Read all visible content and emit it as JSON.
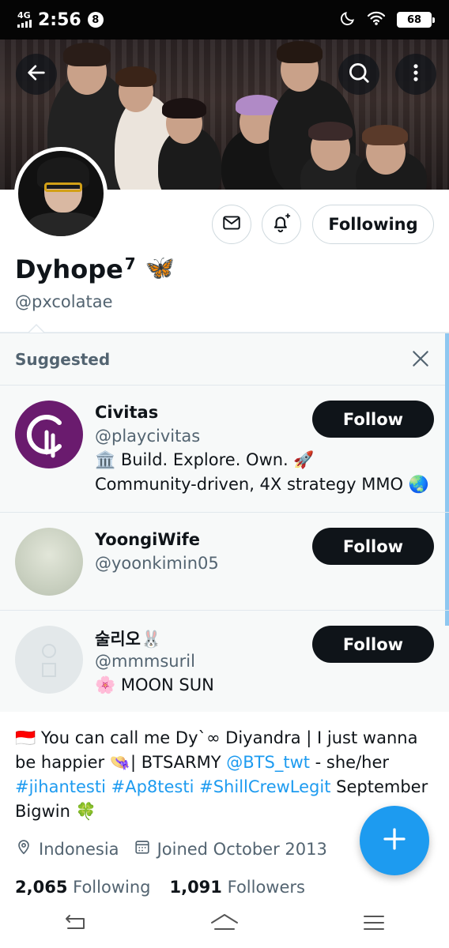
{
  "status_bar": {
    "network": "4G",
    "time": "2:56",
    "notification_count": "8",
    "battery": "68"
  },
  "profile": {
    "display_name": "Dyhope",
    "name_superscript": "7",
    "name_emoji": "🦋",
    "handle": "@pxcolatae",
    "following_label": "Following"
  },
  "suggested": {
    "title": "Suggested",
    "items": [
      {
        "name": "Civitas",
        "handle": "@playcivitas",
        "bio_line1": "🏛️ Build. Explore. Own. 🚀",
        "bio_line2": "Community-driven, 4X strategy MMO 🌏",
        "follow_label": "Follow"
      },
      {
        "name": "YoongiWife",
        "handle": "@yoonkimin05",
        "follow_label": "Follow"
      },
      {
        "name": "술리오🐰",
        "handle": "@mmmsuril",
        "bio_line1": "🌸 MOON SUN",
        "follow_label": "Follow"
      }
    ]
  },
  "bio": {
    "part1": "🇮🇩 You can call me Dy`∞ Diyandra | I just wanna be happier 👒| BTSARMY ",
    "mention": "@BTS_twt",
    "part2": " - she/her ",
    "tag1": "#jihantesti",
    "tag2": "#Ap8testi",
    "tag3": "#ShillCrewLegit",
    "part3": " September Bigwin 🍀"
  },
  "meta": {
    "location": "Indonesia",
    "joined": "Joined October 2013"
  },
  "stats": {
    "following_count": "2,065",
    "following_label": "Following",
    "followers_count": "1,091",
    "followers_label": "Followers"
  },
  "colors": {
    "accent": "#1d9bf0",
    "civitas_purple": "#6a1b6e",
    "follow_btn": "#0f1419"
  }
}
